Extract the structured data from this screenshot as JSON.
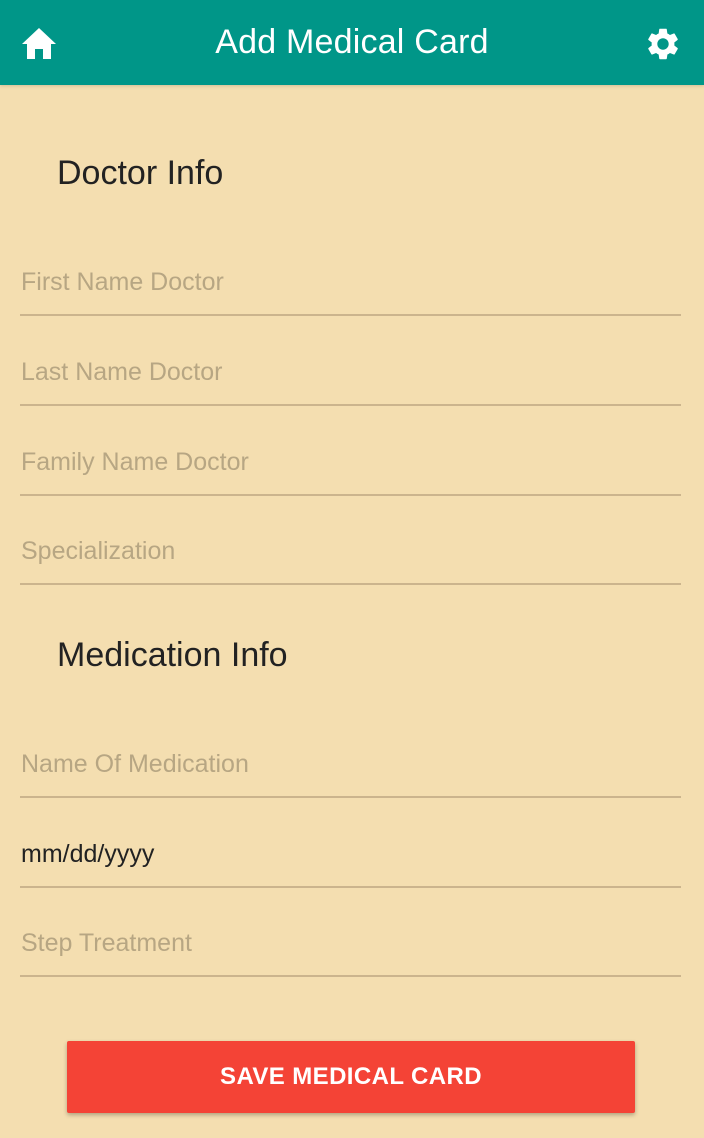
{
  "header": {
    "title": "Add Medical Card",
    "left_icon": "home-icon",
    "right_icon": "gear-icon",
    "background_color": "#009688"
  },
  "doctor_section": {
    "title": "Doctor Info",
    "fields": [
      {
        "placeholder": "First Name Doctor",
        "value": ""
      },
      {
        "placeholder": "Last Name Doctor",
        "value": ""
      },
      {
        "placeholder": "Family Name Doctor",
        "value": ""
      },
      {
        "placeholder": "Specialization",
        "value": ""
      }
    ]
  },
  "medication_section": {
    "title": "Medication Info",
    "name_field": {
      "placeholder": "Name Of Medication",
      "value": ""
    },
    "date_field": {
      "value": "mm/dd/yyyy"
    },
    "step_field": {
      "placeholder": "Step Treatment",
      "value": ""
    }
  },
  "actions": {
    "save_label": "SAVE MEDICAL CARD",
    "save_color": "#f44336"
  },
  "theme": {
    "page_background": "#f4deb0",
    "underline_color": "#cbb48d",
    "placeholder_color": "#b7a683"
  }
}
